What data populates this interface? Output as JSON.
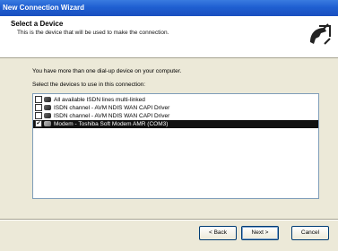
{
  "window": {
    "title": "New Connection Wizard"
  },
  "header": {
    "title": "Select a Device",
    "subtitle": "This is the device that will be used to make the connection.",
    "icon": "phone-connection-icon"
  },
  "body": {
    "intro": "You have more than one dial-up device on your computer.",
    "prompt": "Select the devices to use in this connection:"
  },
  "devices": [
    {
      "label": "All available ISDN lines multi-linked",
      "checked": false,
      "selected": false,
      "icon": "isdn-icon"
    },
    {
      "label": "ISDN  channel - AVM NDIS WAN CAPI Driver",
      "checked": false,
      "selected": false,
      "icon": "isdn-channel-icon"
    },
    {
      "label": "ISDN  channel - AVM NDIS WAN CAPI Driver",
      "checked": false,
      "selected": false,
      "icon": "isdn-channel-icon"
    },
    {
      "label": "Modem - Toshiba Soft Modem AMR (COM3)",
      "checked": true,
      "selected": true,
      "icon": "modem-icon"
    }
  ],
  "buttons": {
    "back": "< Back",
    "next": "Next >",
    "cancel": "Cancel"
  },
  "colors": {
    "title_bar": "#1f5fd1",
    "dialog_bg": "#ece9d8",
    "selection": "#111111"
  }
}
